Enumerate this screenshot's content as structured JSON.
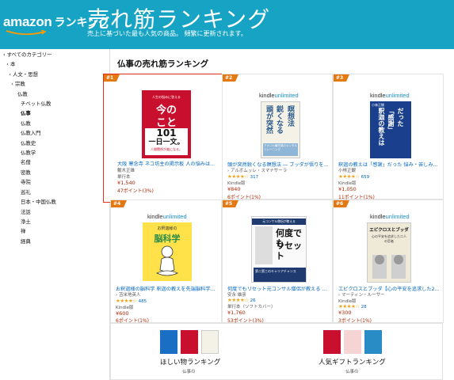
{
  "header": {
    "logo_amazon": "amazon",
    "logo_ranking": "ランキング",
    "title": "売れ筋ランキング",
    "subtitle": "売上に基づいた最も人気の商品。 頻繁に更新されます。",
    "bg_color": "#17a4c4"
  },
  "sidebar": {
    "items": [
      {
        "label": "‹ すべてのカテゴリー",
        "indent": 0
      },
      {
        "label": "本",
        "indent": 1,
        "caret": "‹"
      },
      {
        "label": "人文・思想",
        "indent": 2,
        "caret": "‹"
      },
      {
        "label": "宗教",
        "indent": 3,
        "caret": "‹"
      },
      {
        "label": "仏教",
        "indent": 4
      },
      {
        "label": "チベット仏教",
        "indent": 5
      },
      {
        "label": "仏事",
        "indent": 5,
        "bold": true
      },
      {
        "label": "仏教",
        "indent": 5
      },
      {
        "label": "仏教入門",
        "indent": 5
      },
      {
        "label": "仏教史",
        "indent": 5
      },
      {
        "label": "仏教学",
        "indent": 5
      },
      {
        "label": "名僧",
        "indent": 5
      },
      {
        "label": "密教",
        "indent": 5
      },
      {
        "label": "寺院",
        "indent": 5
      },
      {
        "label": "巡礼",
        "indent": 5
      },
      {
        "label": "日本・中国仏教",
        "indent": 5
      },
      {
        "label": "法話",
        "indent": 5
      },
      {
        "label": "浄土",
        "indent": 5
      },
      {
        "label": "禅",
        "indent": 5
      },
      {
        "label": "経典",
        "indent": 5
      }
    ]
  },
  "main": {
    "title": "仏事の売れ筋ランキング",
    "items": [
      {
        "rank": "#1",
        "ku": false,
        "cover_lines": [
          "今の",
          "こと",
          "101",
          "一日一文。"
        ],
        "cover_sub": "人間関係が楽になる。",
        "cover_top": "人生の悩みに答える",
        "title": "大阪 寒念寺 ネコ坊主の掲示板 人の悩みは...",
        "author": "戴木正雄",
        "format": "単行本",
        "stars": "",
        "reviews": "",
        "price": "¥1,540",
        "points": "47ポイント(3%)"
      },
      {
        "rank": "#2",
        "ku": true,
        "ku_kindle": "kindle",
        "ku_unlimited": "unlimited",
        "cover_lines": [
          "頭が突然",
          "鋭くなる",
          "瞑想法"
        ],
        "cover_sub": "アメリカ最先端のメンタルトレーニング",
        "title": "頭が突然鋭くなる瞑想法 ― ブッダが悟りを...",
        "author": "› アルボムッレ・スマナサーラ",
        "format": "",
        "stars": "★★★★☆",
        "reviews": "317",
        "price": "¥840",
        "points": "6ポイント(1%)"
      },
      {
        "rank": "#3",
        "ku": true,
        "ku_kindle": "kindle",
        "ku_unlimited": "unlimited",
        "cover_lines": [
          "釈迦の教えは",
          "「感謝」",
          "だった"
        ],
        "cover_sub": "小林正観",
        "title": "釈迦の教えは「感謝」だった 悩み・苦しみ...",
        "author": "小林正観",
        "format": "",
        "stars": "★★★★☆",
        "reviews": "659",
        "price": "¥1,050",
        "points": "11ポイント(1%)"
      },
      {
        "rank": "#4",
        "ku": true,
        "ku_kindle": "kindle",
        "ku_unlimited": "unlimited",
        "cover_lines": [
          "お釈迦様の",
          "脳科学"
        ],
        "cover_sub": "",
        "title": "お釈迦様の脳科学 釈迦の教えを先端脳科学...",
        "author": "› 苫米地英人",
        "format": "",
        "stars": "★★★★☆",
        "reviews": "485",
        "price": "¥600",
        "points": "6ポイント(1%)"
      },
      {
        "rank": "#5",
        "ku": false,
        "cover_lines": [
          "何度でも",
          "リセット"
        ],
        "cover_top": "元コンサル僧侶が教える",
        "cover_sub": "第二第三のキャリアチャンス",
        "title": "何度でもリセット元コンサル僧侶が教える ...",
        "author": "安永 雄彦",
        "format": "単行本（ソフトカバー）",
        "stars": "★★★★☆",
        "reviews": "26",
        "price": "¥1,760",
        "points": "53ポイント(3%)"
      },
      {
        "rank": "#6",
        "ku": true,
        "ku_kindle": "kindle",
        "ku_unlimited": "unlimited",
        "cover_lines": [
          "エピクロスとブッダ"
        ],
        "cover_sub": "心の平安を追求した二人の哲者",
        "title": "エピクロスとブッダ【心の平安を追求した2...",
        "author": "› マーティン・ルーサー",
        "format": "Kindle版",
        "stars": "★★★★☆",
        "reviews": "28",
        "price": "¥300",
        "points": "3ポイント(1%)"
      }
    ],
    "format_kindle": "Kindle版"
  },
  "bottom": {
    "left_label": "ほしい物ランキング",
    "left_cat": "仏事の",
    "right_label": "人気ギフトランキング",
    "right_cat": "仏事の"
  }
}
